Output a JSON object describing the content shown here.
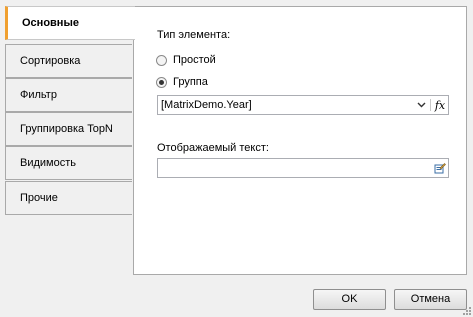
{
  "tabs": [
    {
      "label": "Основные",
      "active": true
    },
    {
      "label": "Сортировка",
      "active": false
    },
    {
      "label": "Фильтр",
      "active": false
    },
    {
      "label": "Группировка TopN",
      "active": false
    },
    {
      "label": "Видимость",
      "active": false
    },
    {
      "label": "Прочие",
      "active": false
    }
  ],
  "main": {
    "element_type_label": "Тип элемента:",
    "radio_simple": "Простой",
    "radio_group": "Группа",
    "selected": "Группа",
    "group_expression": "[MatrixDemo.Year]",
    "fx_label": "fx",
    "display_text_label": "Отображаемый текст:",
    "display_text_value": ""
  },
  "icons": {
    "dropdown": "chevron-down-icon",
    "function": "function-fx-icon",
    "edit": "edit-expression-icon"
  },
  "footer": {
    "ok_label": "OK",
    "cancel_label": "Отмена"
  },
  "colors": {
    "active_tab_accent": "#f0a030"
  }
}
